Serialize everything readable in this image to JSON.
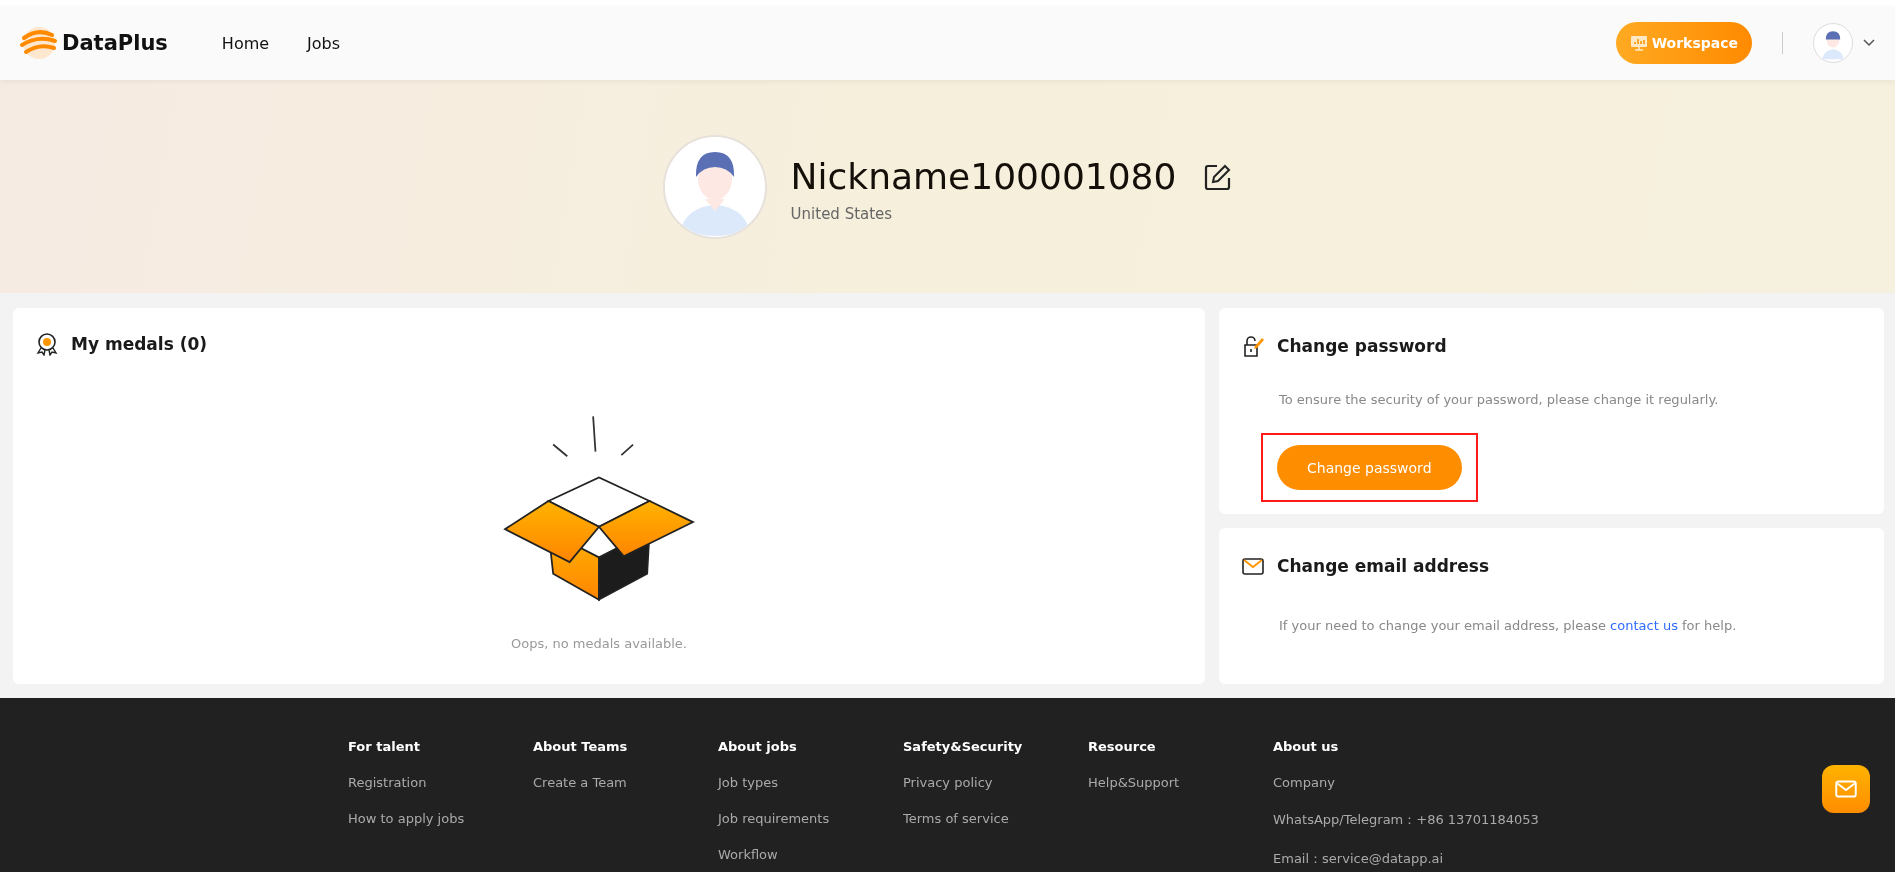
{
  "header": {
    "logo": "DataPlus",
    "nav": [
      {
        "label": "Home"
      },
      {
        "label": "Jobs"
      }
    ],
    "workspace_button": "Workspace"
  },
  "profile": {
    "nickname": "Nickname100001080",
    "country": "United States"
  },
  "medals": {
    "title": "My medals (0)",
    "empty_text": "Oops, no medals available."
  },
  "change_password": {
    "title": "Change password",
    "description": "To ensure the security of your password, please change it regularly.",
    "button": {
      "label": "Change password",
      "highlighted": true
    }
  },
  "change_email": {
    "title": "Change email address",
    "text_before": "If your need to change your email address, please",
    "link": "contact us",
    "text_after": "for help."
  },
  "footer": {
    "columns": [
      {
        "heading": "For talent",
        "links": [
          "Registration",
          "How to apply jobs"
        ]
      },
      {
        "heading": "About Teams",
        "links": [
          "Create a Team"
        ]
      },
      {
        "heading": "About jobs",
        "links": [
          "Job types",
          "Job requirements",
          "Workflow"
        ]
      },
      {
        "heading": "Safety&Security",
        "links": [
          "Privacy policy",
          "Terms of service"
        ]
      },
      {
        "heading": "Resource",
        "links": [
          "Help&Support"
        ]
      },
      {
        "heading": "About us",
        "links": [
          "Company",
          "WhatsApp/Telegram：+86 13701184053",
          "Email：service@datapp.ai"
        ]
      }
    ]
  }
}
